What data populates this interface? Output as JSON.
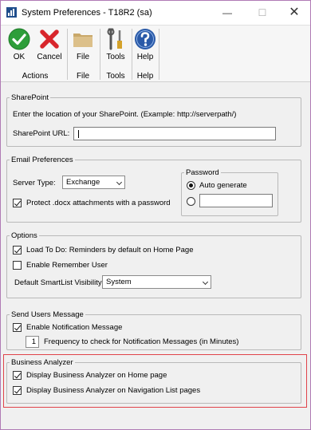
{
  "window": {
    "title": "System Preferences  -  T18R2 (sa)",
    "controls": {
      "minimize": "—",
      "maximize": "☐",
      "close": "✕"
    }
  },
  "ribbon": {
    "ok_label": "OK",
    "cancel_label": "Cancel",
    "actions_group": "Actions",
    "file_label": "File",
    "file_group": "File",
    "tools_label": "Tools",
    "tools_group": "Tools",
    "help_label": "Help",
    "help_group": "Help"
  },
  "sharepoint": {
    "legend": "SharePoint",
    "instruction": "Enter the location of your SharePoint. (Example: http://serverpath/)",
    "url_label": "SharePoint URL:",
    "url_value": ""
  },
  "email": {
    "legend": "Email Preferences",
    "server_type_label": "Server Type:",
    "server_type_value": "Exchange",
    "protect_label": "Protect .docx attachments with a password",
    "protect_checked": true,
    "password": {
      "legend": "Password",
      "auto_generate_label": "Auto generate",
      "auto_generate_selected": true,
      "custom_value": ""
    }
  },
  "options": {
    "legend": "Options",
    "load_todo_label": "Load To Do: Reminders by default on Home Page",
    "load_todo_checked": true,
    "remember_user_label": "Enable Remember User",
    "remember_user_checked": false,
    "smartlist_label": "Default SmartList Visibility:",
    "smartlist_value": "System"
  },
  "send_message": {
    "legend": "Send Users Message",
    "enable_label": "Enable Notification Message",
    "enable_checked": true,
    "frequency_value": "1",
    "frequency_label": "Frequency to check for Notification Messages (in Minutes)"
  },
  "business_analyzer": {
    "legend": "Business Analyzer",
    "home_label": "Display Business Analyzer on Home page",
    "home_checked": true,
    "nav_label": "Display Business Analyzer on Navigation List pages",
    "nav_checked": true
  },
  "colors": {
    "highlight": "#e0434a",
    "ok_green": "#2e9e3a",
    "cancel_red": "#d8262c",
    "help_blue": "#2a5aa8",
    "folder_tan": "#c9a86a"
  }
}
